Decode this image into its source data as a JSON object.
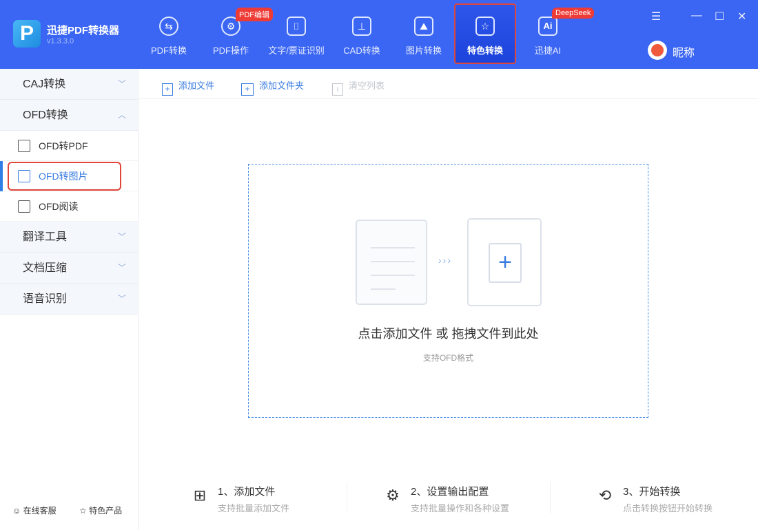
{
  "app": {
    "name": "迅捷PDF转换器",
    "version": "v1.3.3.0",
    "logo_letter": "P"
  },
  "nav": [
    {
      "label": "PDF转换",
      "icon": "⇆"
    },
    {
      "label": "PDF操作",
      "icon": "⚙",
      "badge": "PDF编辑"
    },
    {
      "label": "文字/票证识别",
      "icon": "⌷"
    },
    {
      "label": "CAD转换",
      "icon": "⊥"
    },
    {
      "label": "图片转换",
      "icon": "⛰"
    },
    {
      "label": "特色转换",
      "icon": "☆"
    },
    {
      "label": "迅捷AI",
      "icon": "Ai",
      "badge": "DeepSeek"
    }
  ],
  "user": {
    "nickname": "昵称"
  },
  "sidebar": {
    "groups": [
      {
        "label": "CAJ转换"
      },
      {
        "label": "OFD转换"
      },
      {
        "label": "翻译工具"
      },
      {
        "label": "文档压缩"
      },
      {
        "label": "语音识别"
      }
    ],
    "ofd_items": [
      {
        "label": "OFD转PDF"
      },
      {
        "label": "OFD转图片"
      },
      {
        "label": "OFD阅读"
      }
    ],
    "footer": [
      {
        "label": "在线客服"
      },
      {
        "label": "特色产品"
      }
    ]
  },
  "toolbar": {
    "add_file": "添加文件",
    "add_folder": "添加文件夹",
    "clear_list": "清空列表"
  },
  "dropzone": {
    "main": "点击添加文件 或 拖拽文件到此处",
    "hint": "支持OFD格式",
    "arrows": "›››"
  },
  "steps": [
    {
      "title": "1、添加文件",
      "desc": "支持批量添加文件"
    },
    {
      "title": "2、设置输出配置",
      "desc": "支持批量操作和各种设置"
    },
    {
      "title": "3、开始转换",
      "desc": "点击转换按钮开始转换"
    }
  ],
  "colors": {
    "header": "#3a66f3",
    "accent": "#3a7ce0",
    "highlight": "#e0463a"
  }
}
